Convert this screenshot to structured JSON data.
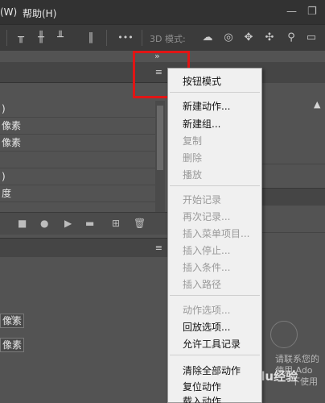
{
  "titlebar": {
    "menu_window_partial": "(W)",
    "menu_help": "帮助(H)",
    "minimize": "—",
    "restore": "❐"
  },
  "optbar": {
    "more_label": "•••",
    "label_3d": "3D 模式:"
  },
  "left_panel": {
    "chevron": "»",
    "rows": [
      "",
      "像素",
      "像素",
      "",
      "",
      "度"
    ],
    "pixel_fields": [
      "像素",
      "像素"
    ]
  },
  "right_panel": {
    "watermark_lines": [
      "请联系您的",
      "使用 Ado",
      "下使用"
    ],
    "brand": "Baidu经验"
  },
  "flyout": {
    "items": [
      {
        "label": "按钮模式",
        "enabled": true
      },
      {
        "label": "新建动作...",
        "enabled": true
      },
      {
        "label": "新建组...",
        "enabled": true
      },
      {
        "label": "复制",
        "enabled": false
      },
      {
        "label": "删除",
        "enabled": false
      },
      {
        "label": "播放",
        "enabled": false
      },
      {
        "label": "开始记录",
        "enabled": false
      },
      {
        "label": "再次记录...",
        "enabled": false
      },
      {
        "label": "插入菜单项目...",
        "enabled": false
      },
      {
        "label": "插入停止...",
        "enabled": false
      },
      {
        "label": "插入条件...",
        "enabled": false
      },
      {
        "label": "插入路径",
        "enabled": false
      },
      {
        "label": "动作选项...",
        "enabled": false
      },
      {
        "label": "回放选项...",
        "enabled": true
      },
      {
        "label": "允许工具记录",
        "enabled": true
      },
      {
        "label": "清除全部动作",
        "enabled": true
      },
      {
        "label": "复位动作",
        "enabled": true
      },
      {
        "label": "载入动作...",
        "enabled": true
      }
    ]
  },
  "colors": {
    "highlight": "#e01515",
    "menu_bg": "#f0f0f0"
  }
}
